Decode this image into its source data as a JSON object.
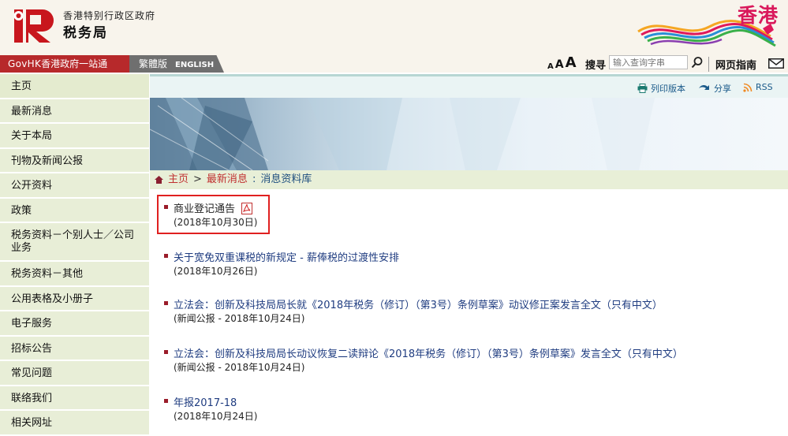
{
  "header": {
    "dept_cn": "香港特别行政区政府",
    "dept_name": "税务局",
    "brand": "香港"
  },
  "topbar": {
    "govhk_prefix": "GovHK",
    "govhk_label": "香港政府一站通",
    "trad_label": "繁體版",
    "english_label": "ENGLISH",
    "font_small": "A",
    "font_medium": "A",
    "font_large": "A",
    "search_label": "搜寻",
    "search_placeholder": "输入查询字串",
    "sitemap_label": "网页指南"
  },
  "sidebar": {
    "items": [
      {
        "label": "主页"
      },
      {
        "label": "最新消息"
      },
      {
        "label": "关于本局"
      },
      {
        "label": "刊物及新闻公报"
      },
      {
        "label": "公开资料"
      },
      {
        "label": "政策"
      },
      {
        "label": "税务资料－个别人士／公司业务"
      },
      {
        "label": "税务资料－其他"
      },
      {
        "label": "公用表格及小册子"
      },
      {
        "label": "电子服务"
      },
      {
        "label": "招标公告"
      },
      {
        "label": "常见问题"
      },
      {
        "label": "联络我们"
      },
      {
        "label": "相关网址"
      }
    ]
  },
  "toolbar": {
    "print_label": "列印版本",
    "share_label": "分享",
    "rss_label": "RSS"
  },
  "breadcrumb": {
    "home": "主页",
    "sep": ">",
    "news": "最新消息",
    "colon": ":",
    "current": "消息资料库"
  },
  "news": [
    {
      "title": "商业登记通告",
      "date": "(2018年10月30日)"
    },
    {
      "title": "关于宽免双重课税的新规定 - 薪俸税的过渡性安排",
      "date": "(2018年10月26日)"
    },
    {
      "title": "立法会：创新及科技局局长就《2018年税务（修订）（第3号）条例草案》动议修正案发言全文（只有中文）",
      "date": "(新闻公报 - 2018年10月24日)"
    },
    {
      "title": "立法会：创新及科技局局长动议恢复二读辩论《2018年税务（修订）（第3号）条例草案》发言全文（只有中文）",
      "date": "(新闻公报 - 2018年10月24日)"
    },
    {
      "title": "年报2017-18",
      "date": "(2018年10月24日)"
    }
  ],
  "colors": {
    "brand_red": "#b7292b",
    "hk_pink": "#d9195b",
    "link_blue": "#1f3c80",
    "sidebar_bg": "#e8eed7",
    "highlight_red": "#e02020"
  }
}
